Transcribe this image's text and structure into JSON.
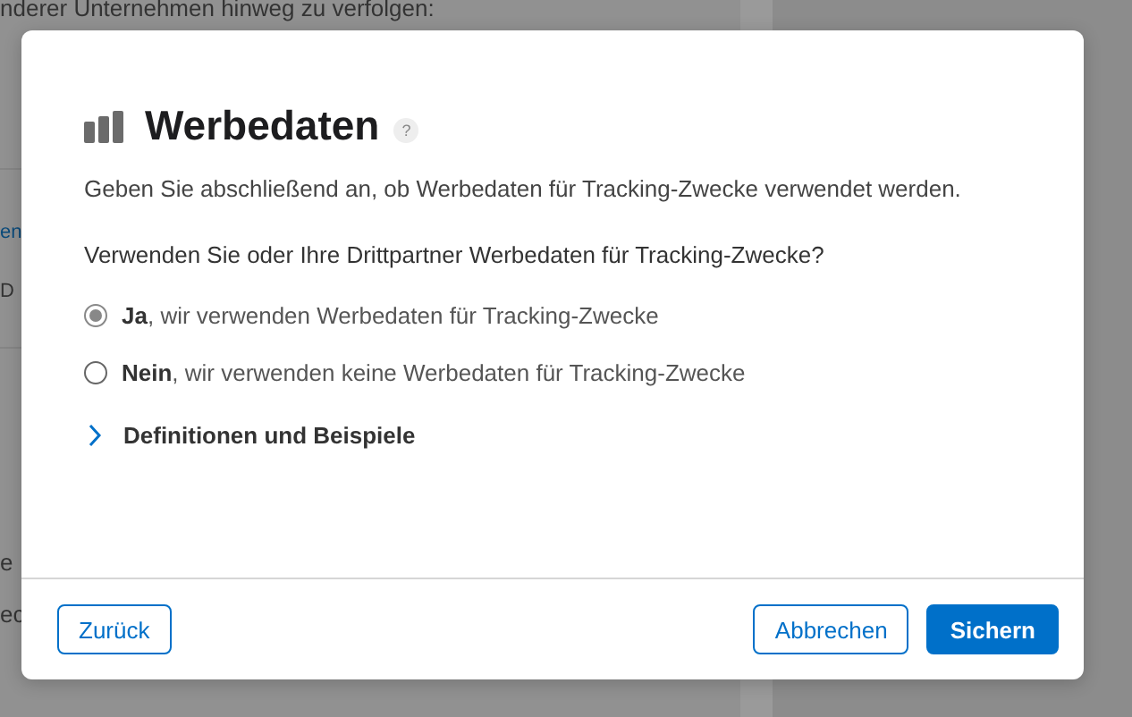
{
  "background": {
    "texts": [
      {
        "kind": "plain",
        "text": "nderer Unternehmen hinweg zu verfolgen:"
      },
      {
        "kind": "link",
        "text": "en"
      },
      {
        "kind": "plain",
        "text": "D"
      },
      {
        "kind": "plain",
        "text": "e"
      },
      {
        "kind": "plain",
        "text": "ec"
      }
    ]
  },
  "dialog": {
    "title": "Werbedaten",
    "help": "?",
    "intro": "Geben Sie abschließend an, ob Werbedaten für Tracking-Zwecke verwendet werden.",
    "question": "Verwenden Sie oder Ihre Drittpartner Werbedaten für Tracking-Zwecke?",
    "options": [
      {
        "label": "**Ja**, wir verwenden Werbedaten für Tracking-Zwecke",
        "selected": true
      },
      {
        "label": "**Nein**, wir verwenden keine Werbedaten für Tracking-Zwecke",
        "selected": false
      }
    ],
    "disclosure": {
      "label": "Definitionen und Beispiele",
      "expanded": false
    },
    "buttons": [
      {
        "label": "Zurück",
        "kind": "secondary"
      },
      {
        "label": "Abbrechen",
        "kind": "secondary"
      },
      {
        "label": "Sichern",
        "kind": "primary"
      }
    ]
  }
}
